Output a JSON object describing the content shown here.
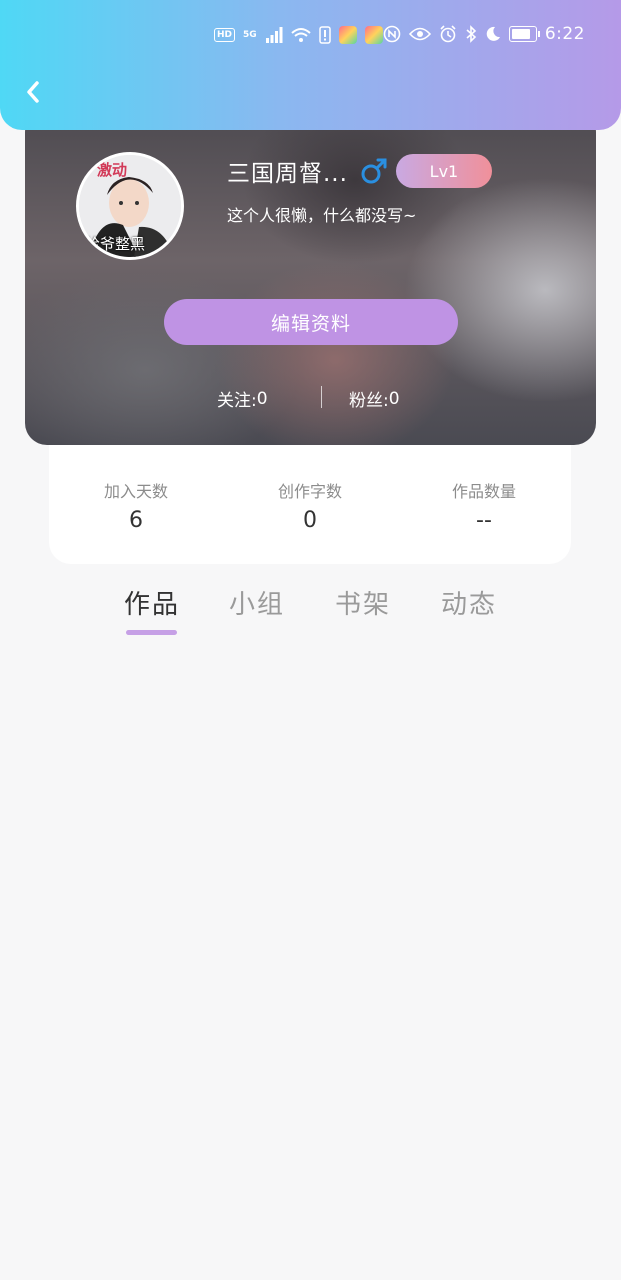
{
  "status_bar": {
    "network_badge": "HD",
    "network_type": "5G",
    "time": "6:22"
  },
  "header": {
    "back_icon": "chevron-left-icon"
  },
  "profile": {
    "nickname": "三国周督...",
    "gender_icon": "male-icon",
    "level": "Lv1",
    "bio": "这个人很懒，什么都没写~",
    "avatar_caption_top": "激动",
    "avatar_caption_bottom": "给爷整黑",
    "edit_button_label": "编辑资料",
    "following_label": "关注: ",
    "following_count": "0",
    "fans_label": "粉丝: ",
    "fans_count": "0"
  },
  "stats": [
    {
      "label": "加入天数",
      "value": "6"
    },
    {
      "label": "创作字数",
      "value": "0"
    },
    {
      "label": "作品数量",
      "value": "--"
    }
  ],
  "tabs": [
    {
      "label": "作品",
      "active": true
    },
    {
      "label": "小组",
      "active": false
    },
    {
      "label": "书架",
      "active": false
    },
    {
      "label": "动态",
      "active": false
    }
  ],
  "colors": {
    "header_gradient_start": "#4fd8f5",
    "header_gradient_end": "#b59ae8",
    "accent_purple": "#bf93e4",
    "tab_indicator": "#c6a0e6",
    "gender_blue": "#2a8fe0",
    "level_gradient_start": "#c9a9e2",
    "level_gradient_end": "#f0909a"
  }
}
